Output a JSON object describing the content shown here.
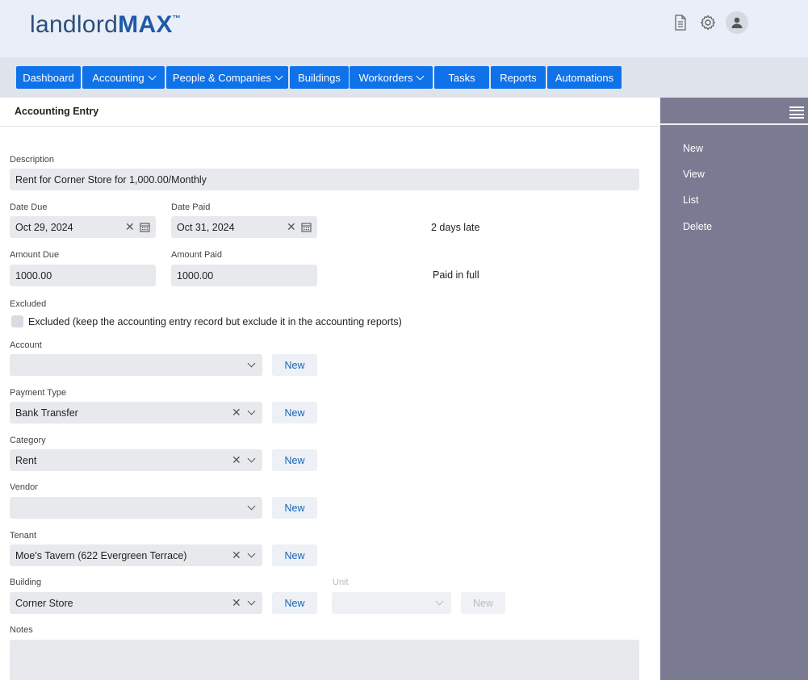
{
  "header": {
    "logo_light": "landlord",
    "logo_bold": "MAX",
    "logo_tm": "™"
  },
  "nav": {
    "dashboard": "Dashboard",
    "accounting": "Accounting",
    "people": "People & Companies",
    "buildings": "Buildings",
    "workorders": "Workorders",
    "tasks": "Tasks",
    "reports": "Reports",
    "automations": "Automations"
  },
  "page": {
    "title": "Accounting Entry"
  },
  "form": {
    "description": {
      "label": "Description",
      "value": "Rent for Corner Store for 1,000.00/Monthly"
    },
    "date_due": {
      "label": "Date Due",
      "value": "Oct 29, 2024"
    },
    "date_paid": {
      "label": "Date Paid",
      "value": "Oct 31, 2024"
    },
    "date_status": "2 days late",
    "amount_due": {
      "label": "Amount Due",
      "value": "1000.00"
    },
    "amount_paid": {
      "label": "Amount Paid",
      "value": "1000.00"
    },
    "amount_status": "Paid in full",
    "excluded": {
      "label": "Excluded",
      "checkbox_label": "Excluded (keep the accounting entry record but exclude it in the accounting reports)"
    },
    "account": {
      "label": "Account",
      "value": ""
    },
    "payment_type": {
      "label": "Payment Type",
      "value": "Bank Transfer"
    },
    "category": {
      "label": "Category",
      "value": "Rent"
    },
    "vendor": {
      "label": "Vendor",
      "value": ""
    },
    "tenant": {
      "label": "Tenant",
      "value": "Moe's Tavern (622 Evergreen Terrace)"
    },
    "building": {
      "label": "Building",
      "value": "Corner Store"
    },
    "unit": {
      "label": "Unit",
      "value": ""
    },
    "notes": {
      "label": "Notes",
      "value": ""
    },
    "new_label": "New"
  },
  "sidebar": {
    "items": [
      "New",
      "View",
      "List",
      "Delete"
    ]
  }
}
